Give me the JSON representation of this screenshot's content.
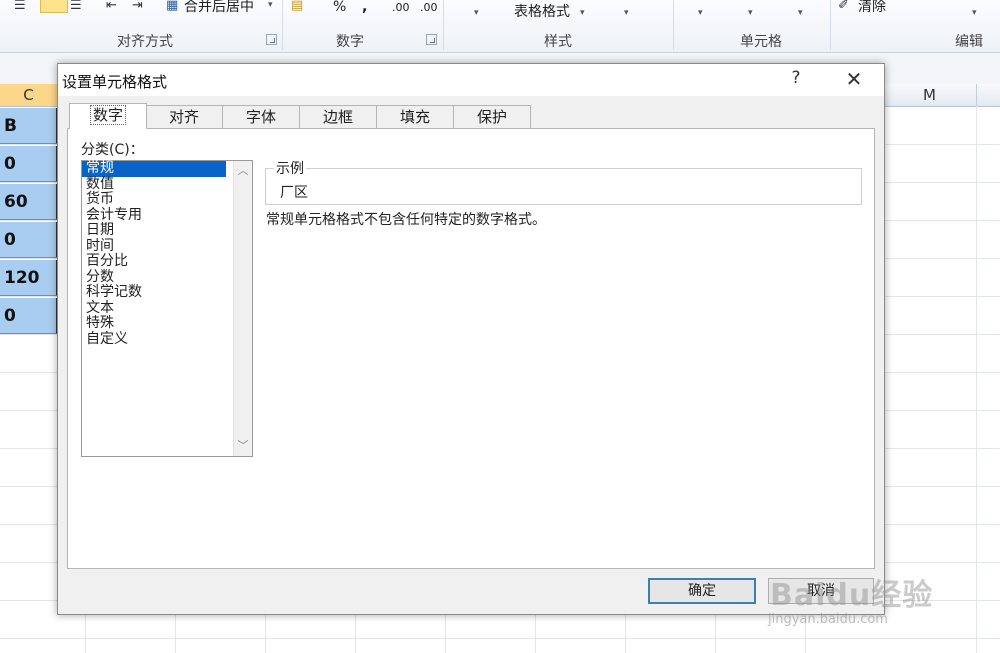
{
  "ribbon": {
    "merge_label": "合并后居中",
    "percent_symbol": "%",
    "comma_symbol": ",",
    "dec_inc": ".00",
    "dec_dec": ".00",
    "table_format_label": "表格格式",
    "clear_label": "清除",
    "groups": {
      "alignment": "对齐方式",
      "number": "数字",
      "styles": "样式",
      "cells": "单元格",
      "editing": "编辑"
    }
  },
  "sheet": {
    "column_c": "C",
    "column_m": "M",
    "cells_c": [
      "B",
      "0",
      "60",
      "0",
      "120",
      "0"
    ]
  },
  "dialog": {
    "title": "设置单元格格式",
    "help": "?",
    "close": "✕",
    "tabs": [
      "数字",
      "对齐",
      "字体",
      "边框",
      "填充",
      "保护"
    ],
    "active_tab": "数字",
    "category_label": "分类(C)：",
    "categories": [
      "常规",
      "数值",
      "货币",
      "会计专用",
      "日期",
      "时间",
      "百分比",
      "分数",
      "科学记数",
      "文本",
      "特殊",
      "自定义"
    ],
    "selected_category": "常规",
    "sample_legend": "示例",
    "sample_value": "厂区",
    "description": "常规单元格格式不包含任何特定的数字格式。",
    "ok_label": "确定",
    "cancel_label": "取消"
  },
  "watermark": {
    "brand": "Baidu经验",
    "url": "jingyan.baidu.com"
  },
  "colors": {
    "selection_blue": "#0a64c8",
    "cell_fill": "#a9cdf0",
    "col_header_selected": "#fcd68a"
  }
}
